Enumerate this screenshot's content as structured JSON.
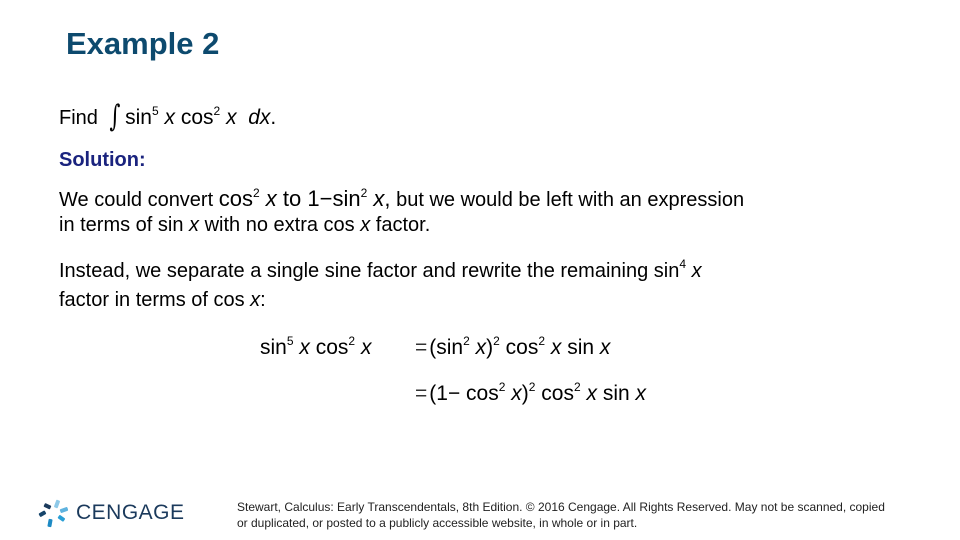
{
  "slide": {
    "title": "Example 2",
    "find": {
      "label": "Find",
      "integral_symbol": "∫",
      "expr": {
        "sin": "sin",
        "sin_exp": "5",
        "x1": "x",
        "cos": "cos",
        "cos_exp": "2",
        "x2": "x",
        "dx": "dx",
        "period": "."
      }
    },
    "solution_label": "Solution:",
    "para1": {
      "before": "We could convert ",
      "expr_a": {
        "cos": "cos",
        "exp": "2",
        "x": "x"
      },
      "to": " to ",
      "expr_b": {
        "one": "1",
        "minus": "−",
        "sin": "sin",
        "exp": "2",
        "x": "x",
        "comma": ","
      },
      "after": " but we would be left with an expression",
      "line2_a": "in terms of sin ",
      "line2_x1": "x",
      "line2_b": " with no extra cos ",
      "line2_x2": "x",
      "line2_c": " factor."
    },
    "para2": {
      "line1": "Instead, we separate a single sine factor and rewrite the remaining ",
      "expr": {
        "sin": "sin",
        "exp": "4",
        "x": "x"
      },
      "line2_a": "factor in terms of cos ",
      "line2_x": "x",
      "line2_b": ":"
    },
    "equation": {
      "lhs": {
        "sin": "sin",
        "sin_exp": "5",
        "x1": "x",
        "cos": "cos",
        "cos_exp": "2",
        "x2": "x"
      },
      "row1": {
        "eq": "=",
        "open": "(sin",
        "exp_in": "2",
        "x": "x",
        "close": ")",
        "exp_out": "2",
        "cos": " cos",
        "cos_exp": "2",
        "x2": "x",
        "sin": " sin ",
        "x3": "x"
      },
      "row2": {
        "eq": "=",
        "open": "(1",
        "minus": "−",
        "cos": " cos",
        "exp_in": "2",
        "x": "x",
        "close": ")",
        "exp_out": "2",
        "cos2": " cos",
        "cos_exp": "2",
        "x2": "x",
        "sin": " sin ",
        "x3": "x"
      }
    },
    "logo": {
      "text": "CENGAGE"
    },
    "footer": "Stewart, Calculus: Early Transcendentals, 8th Edition. © 2016 Cengage. All Rights Reserved. May not be scanned, copied or duplicated, or posted to a publicly accessible website, in whole or in part."
  }
}
